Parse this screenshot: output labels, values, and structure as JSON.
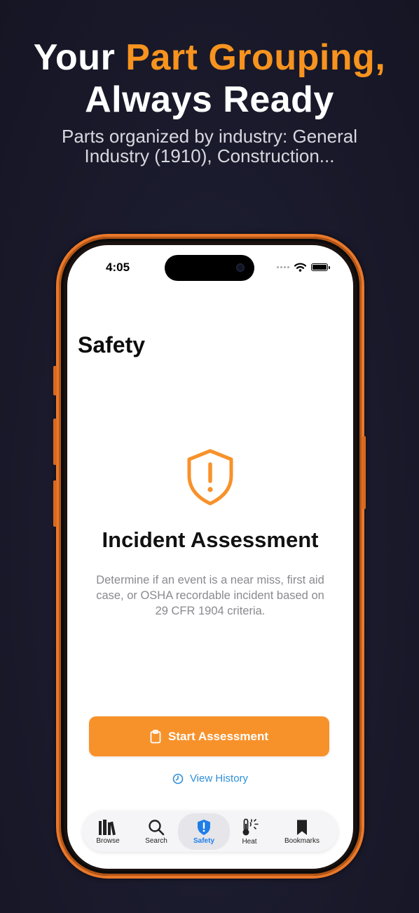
{
  "promo": {
    "title_prefix": "Your",
    "title_accent": "Part Grouping,",
    "title_line2": "Always Ready",
    "subtitle": "Parts organized by industry: General Industry (1910), Construction..."
  },
  "status_bar": {
    "time": "4:05"
  },
  "page": {
    "title": "Safety",
    "heading": "Incident Assessment",
    "description": "Determine if an event is a near miss, first aid case, or OSHA recordable incident based on 29 CFR 1904 criteria.",
    "primary_button": "Start Assessment",
    "secondary_link": "View History"
  },
  "tabs": [
    {
      "label": "Browse",
      "icon": "books-icon"
    },
    {
      "label": "Search",
      "icon": "magnifier-icon"
    },
    {
      "label": "Safety",
      "icon": "shield-icon",
      "active": true
    },
    {
      "label": "Heat",
      "icon": "thermometer-sun-icon"
    },
    {
      "label": "Bookmarks",
      "icon": "bookmark-icon"
    }
  ],
  "colors": {
    "accent": "#f7931e",
    "link": "#2f8fd9",
    "active_tab": "#1f7de8"
  }
}
